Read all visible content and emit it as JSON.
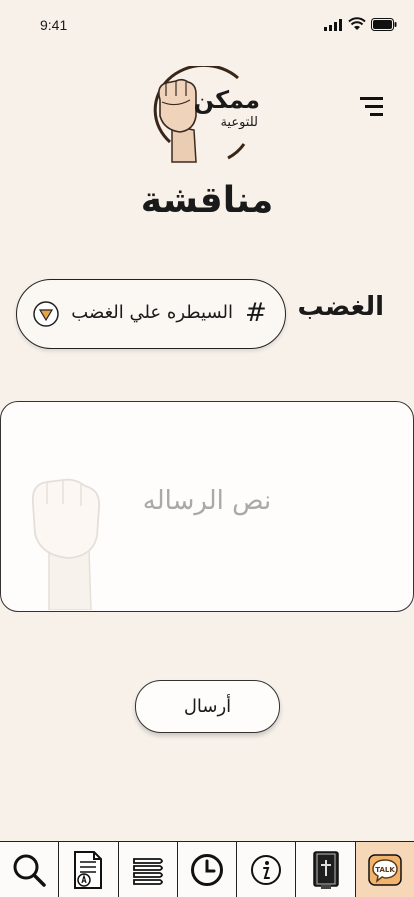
{
  "status_bar": {
    "time": "9:41"
  },
  "logo": {
    "line1": "ممكن",
    "line2": "للتوعية"
  },
  "page": {
    "title": "مناقشة"
  },
  "topic": {
    "label": "الغضب",
    "hash": "#",
    "selected": "السيطره علي الغضب"
  },
  "message": {
    "placeholder": "نص الرساله"
  },
  "send": {
    "label": "أرسال"
  },
  "nav": {
    "items": [
      {
        "icon": "search-icon"
      },
      {
        "icon": "document-icon"
      },
      {
        "icon": "books-icon"
      },
      {
        "icon": "clock-icon"
      },
      {
        "icon": "info-icon"
      },
      {
        "icon": "bible-icon"
      },
      {
        "icon": "talk-icon",
        "text": "TALK"
      }
    ]
  },
  "colors": {
    "background": "#f8f1ea",
    "accent": "#f6d7b8",
    "dropdown": "#e8a24a"
  }
}
